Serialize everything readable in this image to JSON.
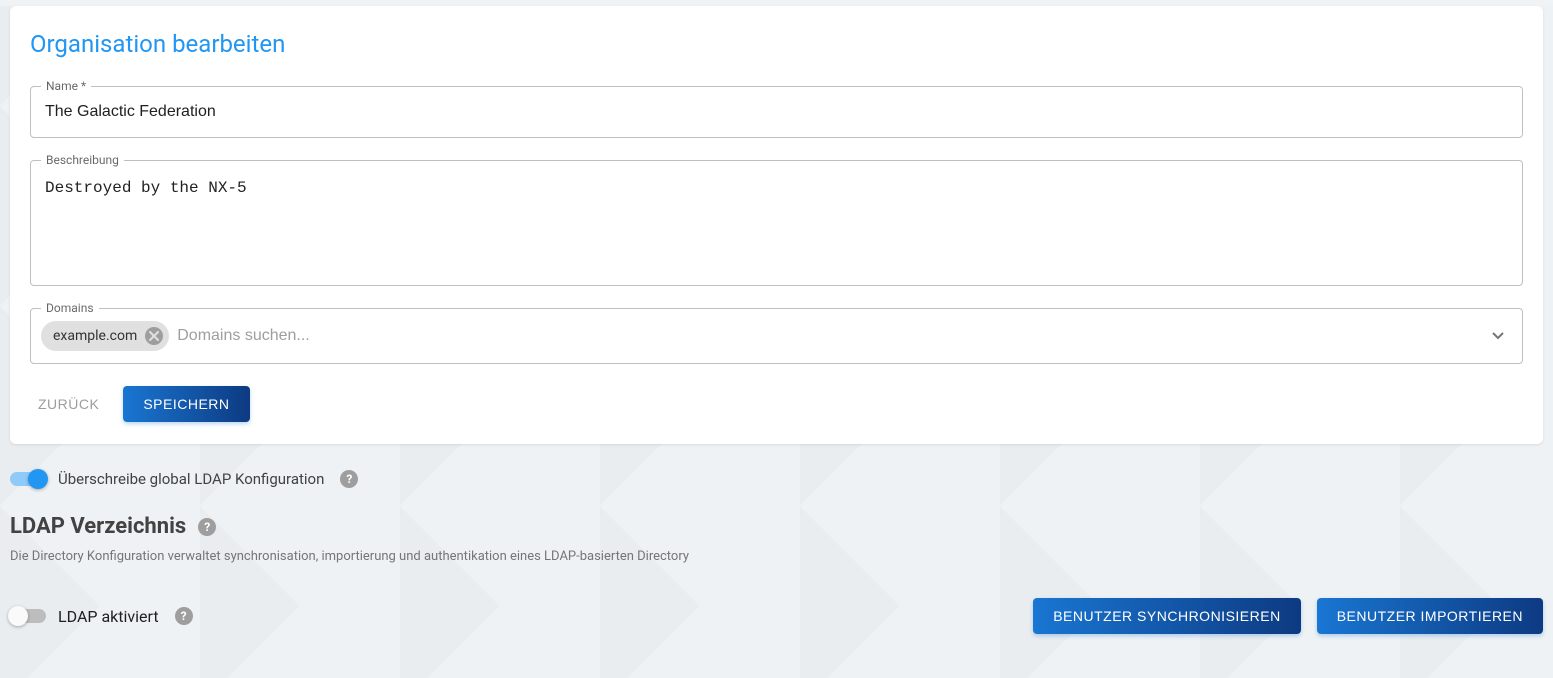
{
  "card": {
    "title": "Organisation bearbeiten",
    "name_label": "Name *",
    "name_value": "The Galactic Federation",
    "desc_label": "Beschreibung",
    "desc_value": "Destroyed by the NX-5",
    "domains_label": "Domains",
    "domains_chips": [
      "example.com"
    ],
    "domains_placeholder": "Domains suchen...",
    "back_label": "ZURÜCK",
    "save_label": "SPEICHERN"
  },
  "ldap": {
    "override_toggle_on": true,
    "override_label": "Überschreibe global LDAP Konfiguration",
    "heading": "LDAP Verzeichnis",
    "description": "Die Directory Konfiguration verwaltet synchronisation, importierung und authentikation eines LDAP-basierten Directory",
    "enabled_toggle_on": false,
    "enabled_label": "LDAP aktiviert",
    "sync_button": "BENUTZER SYNCHRONISIEREN",
    "import_button": "BENUTZER IMPORTIEREN"
  }
}
